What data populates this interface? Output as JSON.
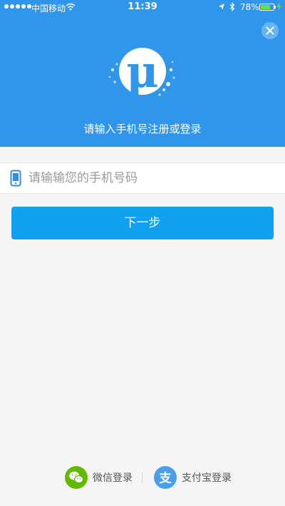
{
  "status_bar": {
    "carrier": "中国移动",
    "time": "11:39",
    "battery_percent": "78%",
    "battery_level": 0.78
  },
  "header": {
    "prompt": "请输入手机号注册或登录",
    "logo_letter": "μ",
    "close_icon": "close-icon"
  },
  "phone_field": {
    "placeholder": "请输输您的手机号码",
    "icon": "phone-icon"
  },
  "next_button": {
    "label": "下一步"
  },
  "social_login": {
    "wechat_label": "微信登录",
    "alipay_label": "支付宝登录",
    "alipay_glyph": "支"
  },
  "colors": {
    "header_blue": "#2f96ec",
    "button_blue": "#12a1ee",
    "wechat_green": "#62b900",
    "alipay_blue": "#4a9fe8",
    "battery_green": "#5fe04c"
  }
}
